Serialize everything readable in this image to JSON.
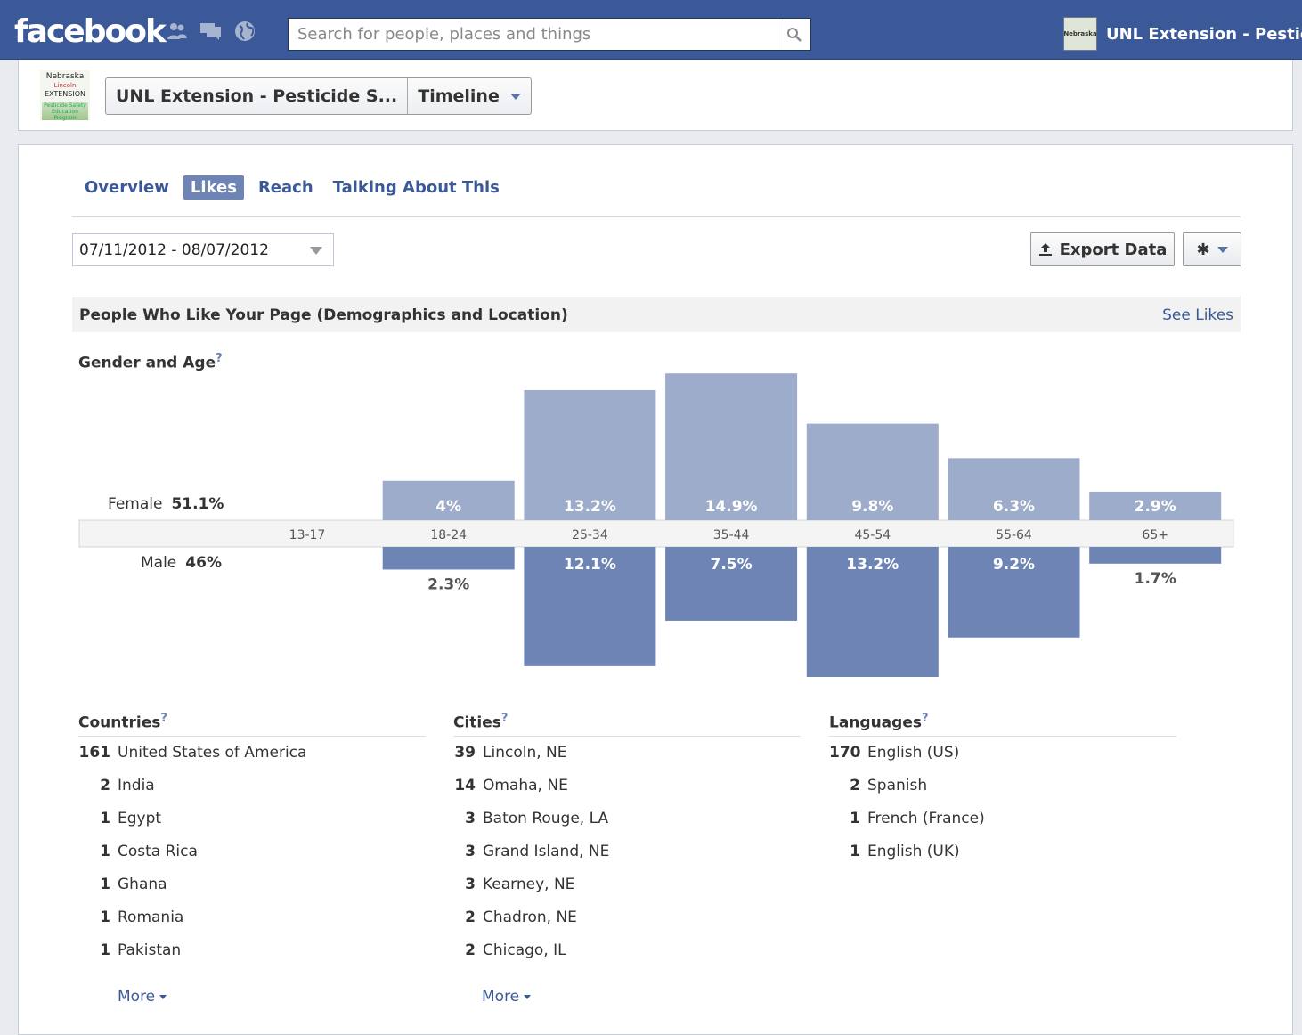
{
  "topbar": {
    "logo": "facebook",
    "search_placeholder": "Search for people, places and things",
    "account_name": "UNL Extension - Pestici",
    "account_thumb_text": "Nebraska"
  },
  "page_header": {
    "thumb_text": [
      "Nebraska",
      "Lincoln",
      "EXTENSION",
      "Pesticide Safety Education Program"
    ],
    "page_name": "UNL Extension - Pesticide S...",
    "timeline_label": "Timeline"
  },
  "tabs": [
    {
      "label": "Overview",
      "active": false
    },
    {
      "label": "Likes",
      "active": true
    },
    {
      "label": "Reach",
      "active": false
    },
    {
      "label": "Talking About This",
      "active": false
    }
  ],
  "date_range": "07/11/2012 - 08/07/2012",
  "export_label": "Export Data",
  "section": {
    "title": "People Who Like Your Page (Demographics and Location)",
    "see_likes": "See Likes"
  },
  "gender_age": {
    "title": "Gender and Age",
    "help": "?",
    "female_label": "Female",
    "female_total": "51.1%",
    "male_label": "Male",
    "male_total": "46%"
  },
  "chart_data": {
    "type": "bar",
    "categories": [
      "13-17",
      "18-24",
      "25-34",
      "35-44",
      "45-54",
      "55-64",
      "65+"
    ],
    "series": [
      {
        "name": "Female",
        "values": [
          null,
          4,
          13.2,
          14.9,
          9.8,
          6.3,
          2.9
        ],
        "labels": [
          "",
          "4%",
          "13.2%",
          "14.9%",
          "9.8%",
          "6.3%",
          "2.9%"
        ],
        "color": "#9daccb"
      },
      {
        "name": "Male",
        "values": [
          null,
          2.3,
          12.1,
          7.5,
          13.2,
          9.2,
          1.7
        ],
        "labels": [
          "",
          "2.3%",
          "12.1%",
          "7.5%",
          "13.2%",
          "9.2%",
          "1.7%"
        ],
        "color": "#6d84b4"
      }
    ]
  },
  "countries": {
    "title": "Countries",
    "help": "?",
    "items": [
      {
        "count": "161",
        "name": "United States of America"
      },
      {
        "count": "2",
        "name": "India"
      },
      {
        "count": "1",
        "name": "Egypt"
      },
      {
        "count": "1",
        "name": "Costa Rica"
      },
      {
        "count": "1",
        "name": "Ghana"
      },
      {
        "count": "1",
        "name": "Romania"
      },
      {
        "count": "1",
        "name": "Pakistan"
      }
    ],
    "more": "More"
  },
  "cities": {
    "title": "Cities",
    "help": "?",
    "items": [
      {
        "count": "39",
        "name": "Lincoln, NE"
      },
      {
        "count": "14",
        "name": "Omaha, NE"
      },
      {
        "count": "3",
        "name": "Baton Rouge, LA"
      },
      {
        "count": "3",
        "name": "Grand Island, NE"
      },
      {
        "count": "3",
        "name": "Kearney, NE"
      },
      {
        "count": "2",
        "name": "Chadron, NE"
      },
      {
        "count": "2",
        "name": "Chicago, IL"
      }
    ],
    "more": "More"
  },
  "languages": {
    "title": "Languages",
    "help": "?",
    "items": [
      {
        "count": "170",
        "name": "English (US)"
      },
      {
        "count": "2",
        "name": "Spanish"
      },
      {
        "count": "1",
        "name": "French (France)"
      },
      {
        "count": "1",
        "name": "English (UK)"
      }
    ]
  }
}
